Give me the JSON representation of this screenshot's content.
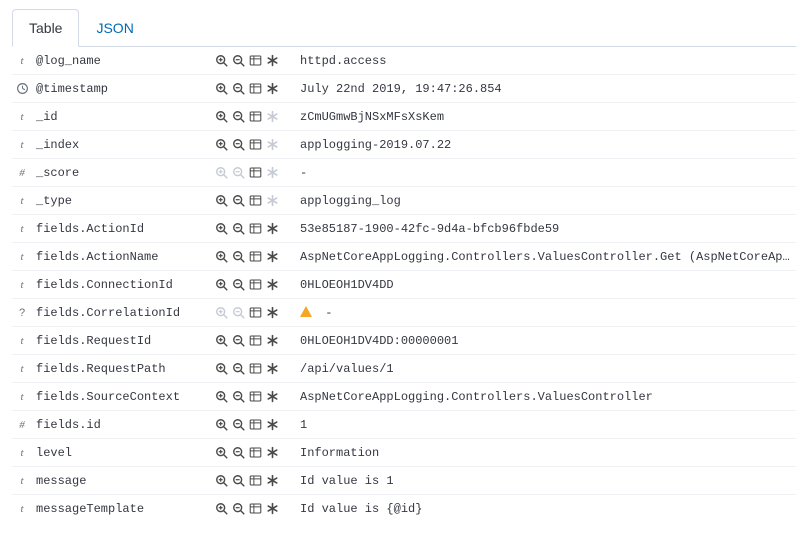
{
  "tabs": {
    "table": "Table",
    "json": "JSON"
  },
  "rows": [
    {
      "type": "t",
      "name": "@log_name",
      "value": "httpd.access",
      "actionsDisabled": false,
      "asteriskDisabled": false,
      "warn": false
    },
    {
      "type": "time",
      "name": "@timestamp",
      "value": "July 22nd 2019, 19:47:26.854",
      "actionsDisabled": false,
      "asteriskDisabled": false,
      "warn": false
    },
    {
      "type": "t",
      "name": "_id",
      "value": "zCmUGmwBjNSxMFsXsKem",
      "actionsDisabled": false,
      "asteriskDisabled": true,
      "warn": false
    },
    {
      "type": "t",
      "name": "_index",
      "value": "applogging-2019.07.22",
      "actionsDisabled": false,
      "asteriskDisabled": true,
      "warn": false
    },
    {
      "type": "#",
      "name": "_score",
      "value": " -",
      "actionsDisabled": true,
      "asteriskDisabled": true,
      "warn": false
    },
    {
      "type": "t",
      "name": "_type",
      "value": "applogging_log",
      "actionsDisabled": false,
      "asteriskDisabled": true,
      "warn": false
    },
    {
      "type": "t",
      "name": "fields.ActionId",
      "value": "53e85187-1900-42fc-9d4a-bfcb96fbde59",
      "actionsDisabled": false,
      "asteriskDisabled": false,
      "warn": false
    },
    {
      "type": "t",
      "name": "fields.ActionName",
      "value": "AspNetCoreAppLogging.Controllers.ValuesController.Get (AspNetCoreAppLogging)",
      "actionsDisabled": false,
      "asteriskDisabled": false,
      "warn": false
    },
    {
      "type": "t",
      "name": "fields.ConnectionId",
      "value": "0HLOEOH1DV4DD",
      "actionsDisabled": false,
      "asteriskDisabled": false,
      "warn": false
    },
    {
      "type": "?",
      "name": "fields.CorrelationId",
      "value": " -",
      "actionsDisabled": true,
      "asteriskDisabled": false,
      "warn": true
    },
    {
      "type": "t",
      "name": "fields.RequestId",
      "value": "0HLOEOH1DV4DD:00000001",
      "actionsDisabled": false,
      "asteriskDisabled": false,
      "warn": false
    },
    {
      "type": "t",
      "name": "fields.RequestPath",
      "value": "/api/values/1",
      "actionsDisabled": false,
      "asteriskDisabled": false,
      "warn": false
    },
    {
      "type": "t",
      "name": "fields.SourceContext",
      "value": "AspNetCoreAppLogging.Controllers.ValuesController",
      "actionsDisabled": false,
      "asteriskDisabled": false,
      "warn": false
    },
    {
      "type": "#",
      "name": "fields.id",
      "value": "1",
      "actionsDisabled": false,
      "asteriskDisabled": false,
      "warn": false
    },
    {
      "type": "t",
      "name": "level",
      "value": "Information",
      "actionsDisabled": false,
      "asteriskDisabled": false,
      "warn": false
    },
    {
      "type": "t",
      "name": "message",
      "value": "Id value is 1",
      "actionsDisabled": false,
      "asteriskDisabled": false,
      "warn": false
    },
    {
      "type": "t",
      "name": "messageTemplate",
      "value": "Id value is {@id}",
      "actionsDisabled": false,
      "asteriskDisabled": false,
      "warn": false
    }
  ]
}
